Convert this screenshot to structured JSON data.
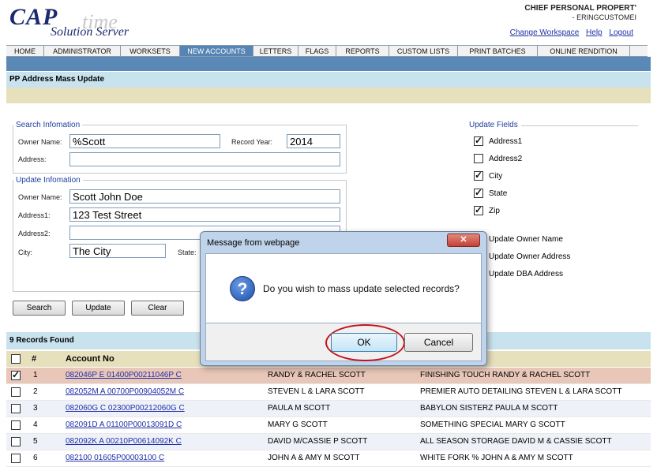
{
  "header": {
    "logo_cap": "CAP",
    "logo_time": "time",
    "logo_server": "Solution Server",
    "title": "CHIEF  PERSONAL PROPERT'",
    "subtitle": "- ERINGCUSTOMEI",
    "links": [
      "Change Workspace",
      "Help",
      "Logout"
    ],
    "edge_chars": "s\nd"
  },
  "nav": {
    "tabs": [
      "HOME",
      "ADMINISTRATOR",
      "WORKSETS",
      "NEW ACCOUNTS",
      "LETTERS",
      "FLAGS",
      "REPORTS",
      "CUSTOM LISTS",
      "PRINT BATCHES",
      "ONLINE RENDITION"
    ],
    "active": "NEW ACCOUNTS"
  },
  "page": {
    "section_title": "PP Address Mass Update"
  },
  "search": {
    "legend": "Search Infomation",
    "owner_name_label": "Owner Name:",
    "owner_name_value": "%Scott",
    "record_year_label": "Record Year:",
    "record_year_value": "2014",
    "address_label": "Address:",
    "address_value": ""
  },
  "update": {
    "legend": "Update Infomation",
    "owner_name_label": "Owner Name:",
    "owner_name_value": "Scott John Doe",
    "address1_label": "Address1:",
    "address1_value": "123 Test Street",
    "address2_label": "Address2:",
    "address2_value": "",
    "city_label": "City:",
    "city_value": "The City",
    "state_label": "State:"
  },
  "update_fields": {
    "legend": "Update Fields",
    "items": [
      {
        "label": "Address1",
        "checked": true
      },
      {
        "label": "Address2",
        "checked": false
      },
      {
        "label": "City",
        "checked": true
      },
      {
        "label": "State",
        "checked": true
      },
      {
        "label": "Zip",
        "checked": true
      }
    ],
    "options": [
      "Update Owner Name",
      "Update Owner Address",
      "Update DBA Address"
    ]
  },
  "buttons": {
    "search": "Search",
    "update": "Update",
    "clear": "Clear"
  },
  "records": {
    "found_label": "9 Records Found",
    "columns": [
      "#",
      "Account No"
    ],
    "rows": [
      {
        "num": "1",
        "account": "082046P E 01400P00211046P C",
        "owner": "RANDY & RACHEL SCOTT",
        "dba": "FINISHING TOUCH RANDY & RACHEL SCOTT",
        "checked": true
      },
      {
        "num": "2",
        "account": "082052M A 00700P00904052M C",
        "owner": "STEVEN L & LARA SCOTT",
        "dba": "PREMIER AUTO DETAILING STEVEN L & LARA SCOTT",
        "checked": false
      },
      {
        "num": "3",
        "account": "082060G C 02300P00212060G C",
        "owner": "PAULA M SCOTT",
        "dba": "BABYLON SISTERZ PAULA M SCOTT",
        "checked": false
      },
      {
        "num": "4",
        "account": "082091D A 01100P00013091D C",
        "owner": "MARY G SCOTT",
        "dba": "SOMETHING SPECIAL MARY G SCOTT",
        "checked": false
      },
      {
        "num": "5",
        "account": "082092K A 00210P00614092K C",
        "owner": "DAVID M/CASSIE P SCOTT",
        "dba": "ALL SEASON STORAGE DAVID M & CASSIE SCOTT",
        "checked": false
      },
      {
        "num": "6",
        "account": "082100 01605P00003100 C",
        "owner": "JOHN A & AMY M SCOTT",
        "dba": "WHITE FORK % JOHN A & AMY M SCOTT",
        "checked": false
      }
    ]
  },
  "dialog": {
    "title": "Message from webpage",
    "close_glyph": "✕",
    "icon": "question-icon",
    "icon_glyph": "?",
    "message": "Do you wish to mass update selected records?",
    "ok": "OK",
    "cancel": "Cancel"
  },
  "colors": {
    "nav_active": "#5585b5",
    "section_bg": "#c9e3ee",
    "tan_bar": "#e7e0bd",
    "selected_row": "#e9c7b8",
    "highlight_ring": "#c0141b"
  }
}
